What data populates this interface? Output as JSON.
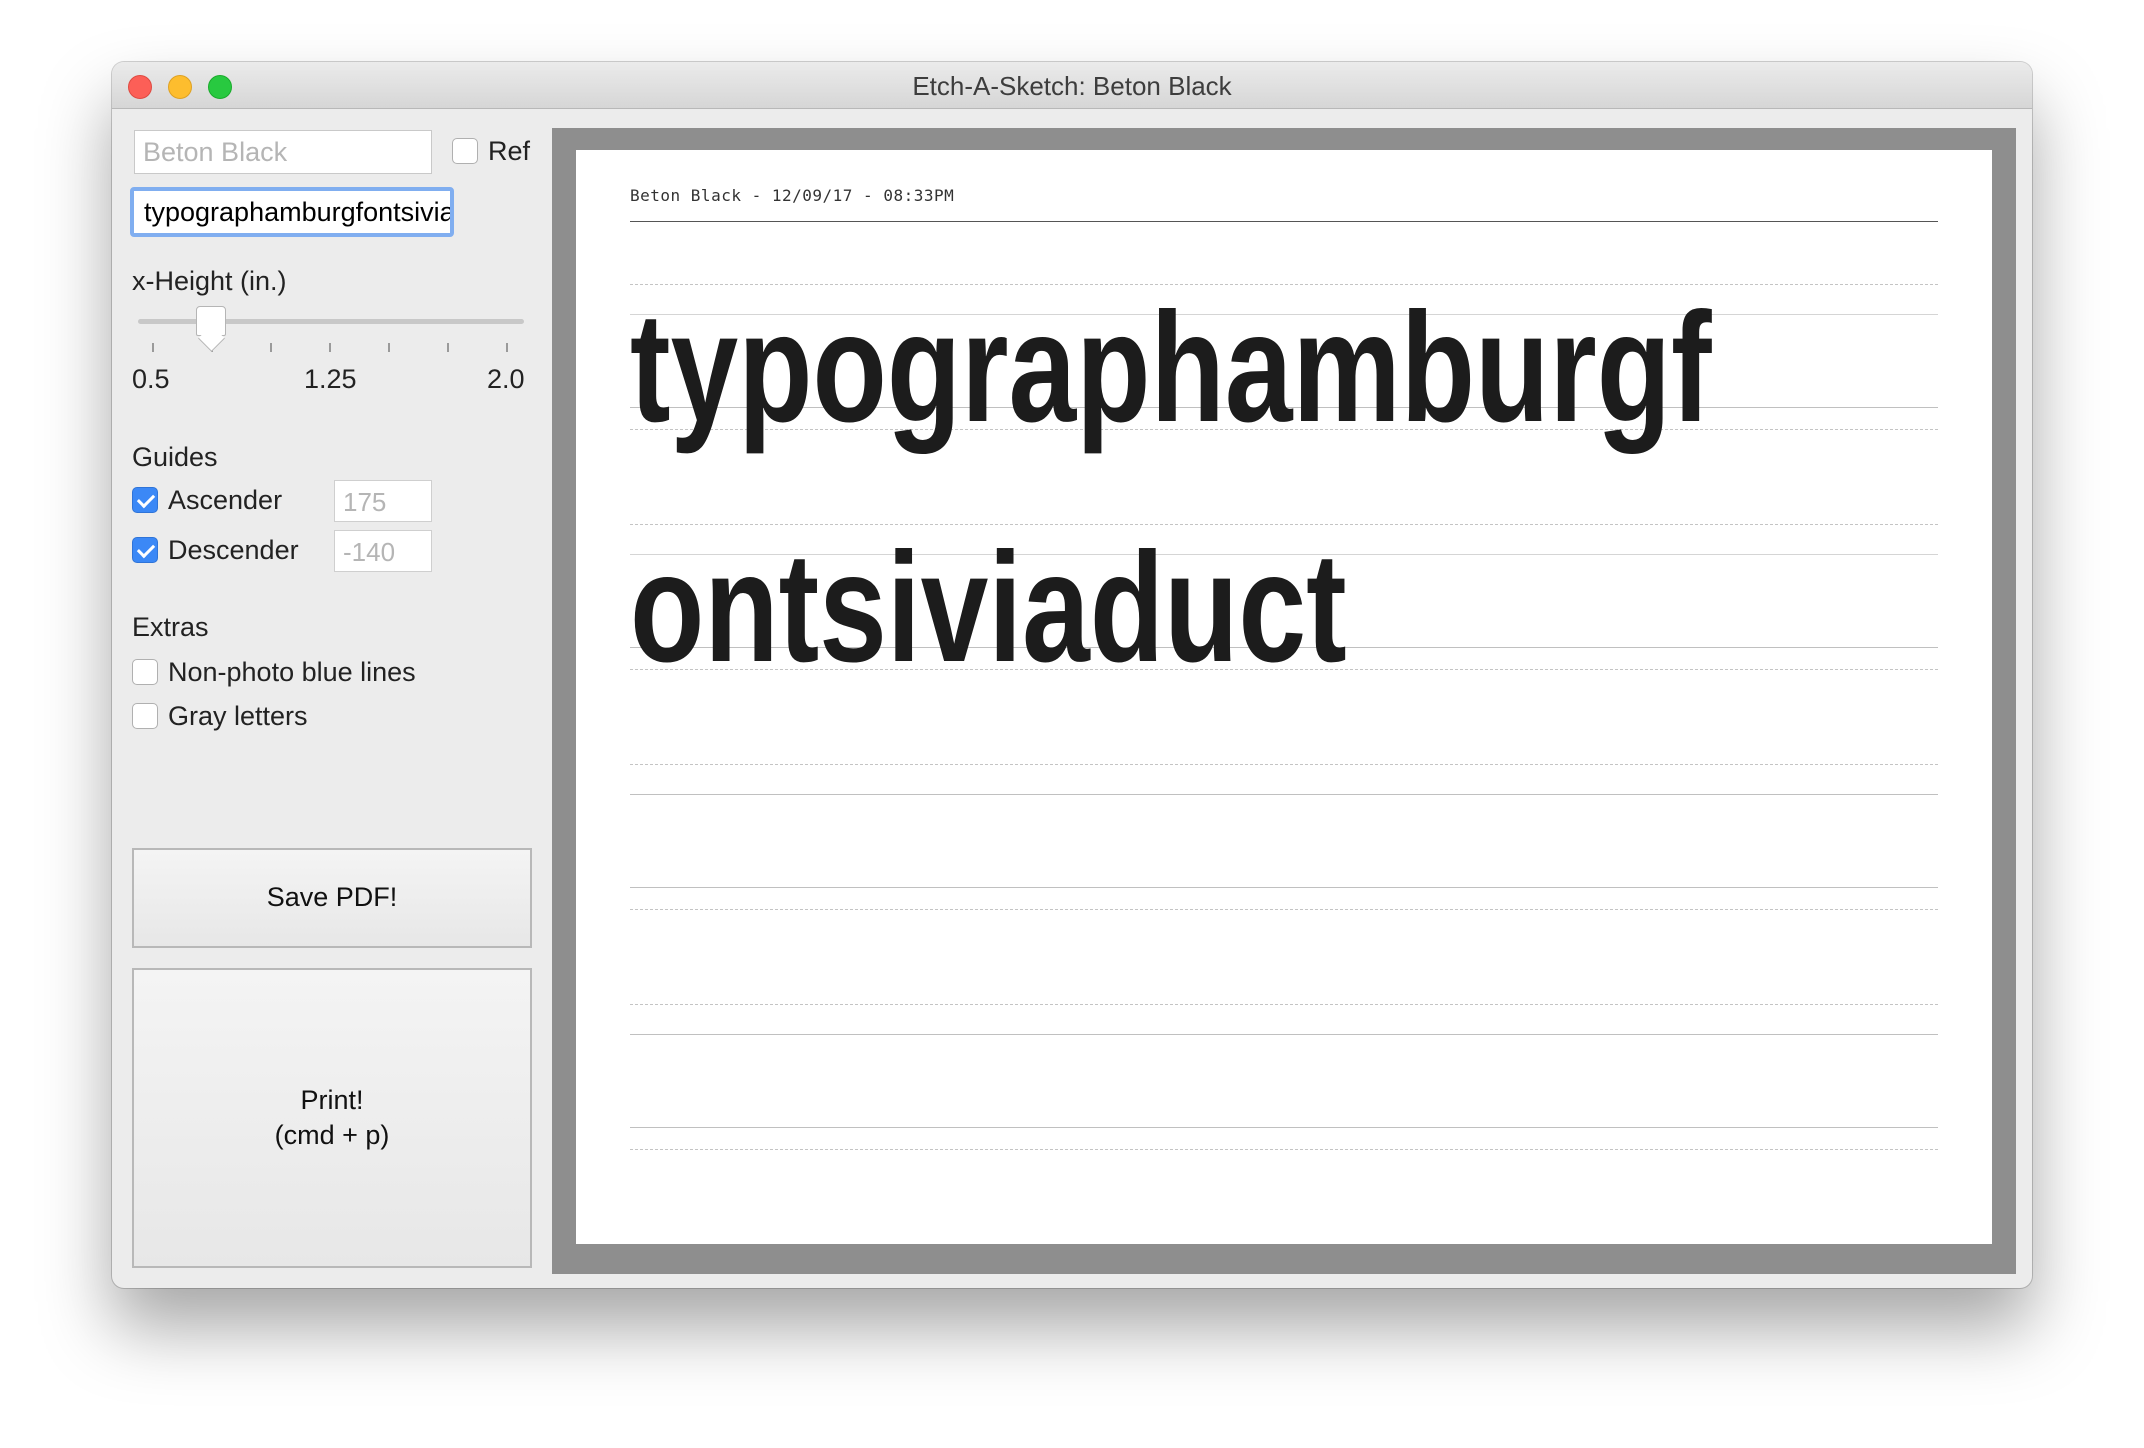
{
  "window": {
    "title": "Etch-A-Sketch: Beton Black"
  },
  "sidebar": {
    "font_field_placeholder": "Beton Black",
    "ref_label": "Ref",
    "text_value": "typographamburgfontsiviaduct",
    "xheight_label": "x-Height (in.)",
    "slider_min": "0.5",
    "slider_mid": "1.25",
    "slider_max": "2.0",
    "slider_value_fraction": 0.19,
    "guides_heading": "Guides",
    "ascender_label": "Ascender",
    "ascender_placeholder": "175",
    "descender_label": "Descender",
    "descender_placeholder": "-140",
    "extras_heading": "Extras",
    "nonphoto_label": "Non-photo blue lines",
    "gray_label": "Gray letters",
    "save_button": "Save PDF!",
    "print_button_line1": "Print!",
    "print_button_line2": "(cmd + p)"
  },
  "preview": {
    "header": "Beton Black - 12/09/17 - 08:33PM",
    "line1": "typographamburgf",
    "line2": "ontsiviaduct"
  },
  "colors": {
    "accent": "#3b88f6",
    "preview_frame": "#8e8e8e",
    "text_dark": "#1c1c1c"
  }
}
